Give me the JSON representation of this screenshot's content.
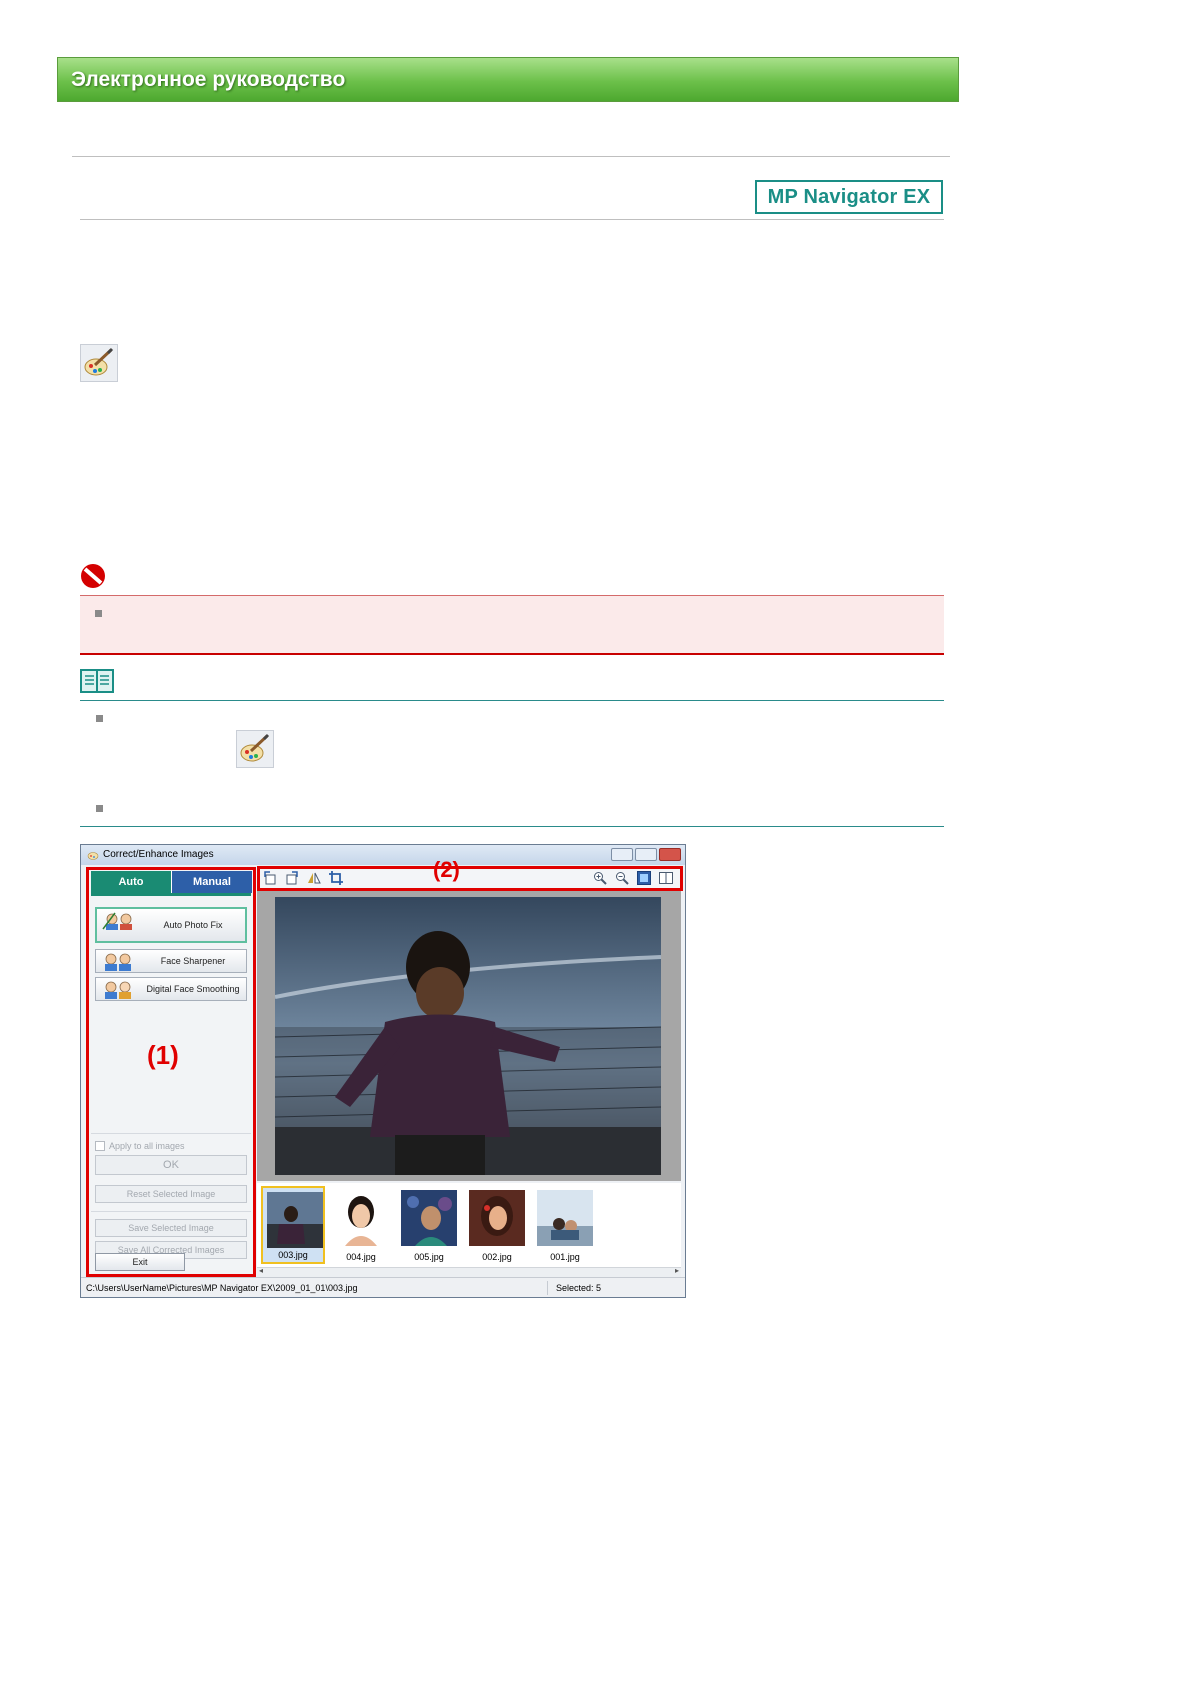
{
  "header": {
    "title": "Электронное руководство"
  },
  "product_logo": "MP Navigator EX",
  "window": {
    "title": "Correct/Enhance Images",
    "tabs": [
      "Auto",
      "Manual"
    ],
    "tools": [
      "Auto Photo Fix",
      "Face Sharpener",
      "Digital Face Smoothing"
    ],
    "apply_all_label": "Apply to all images",
    "ok_label": "OK",
    "reset_label": "Reset Selected Image",
    "save_selected_label": "Save Selected Image",
    "save_all_label": "Save All Corrected Images",
    "exit_label": "Exit",
    "thumbnails": [
      "003.jpg",
      "004.jpg",
      "005.jpg",
      "002.jpg",
      "001.jpg"
    ],
    "status_path": "C:\\Users\\UserName\\Pictures\\MP Navigator EX\\2009_01_01\\003.jpg",
    "status_selected": "Selected: 5"
  },
  "callouts": {
    "left": "(1)",
    "top": "(2)"
  },
  "colors": {
    "banner_green": "#6cc04a",
    "logo_teal": "#1a8e86",
    "caution_red": "#c80000",
    "note_teal": "#2a8b8b",
    "callout_red": "#e00000"
  }
}
